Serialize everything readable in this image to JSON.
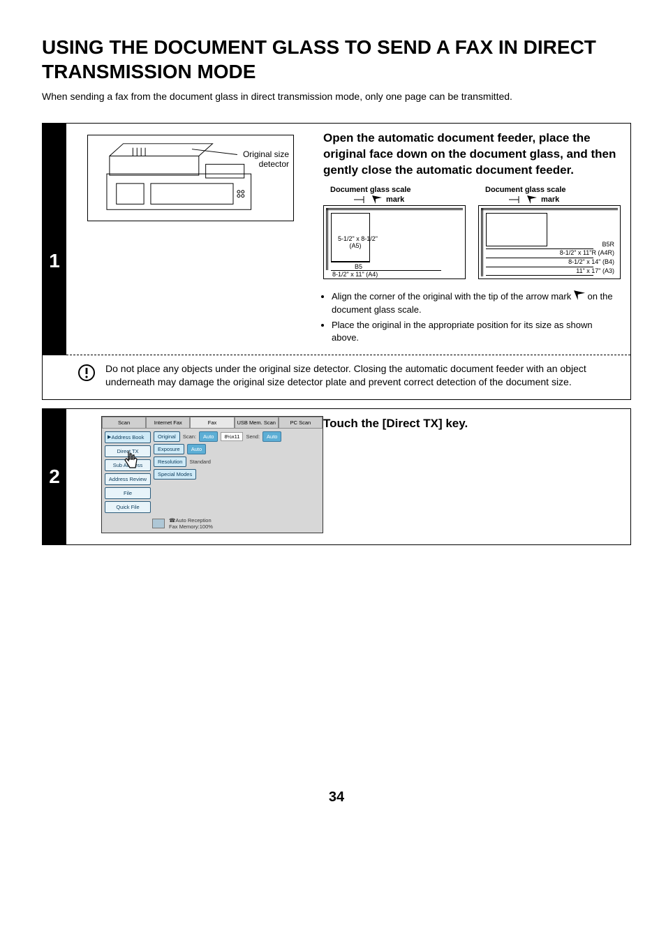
{
  "title": "USING THE DOCUMENT GLASS TO SEND A FAX IN DIRECT TRANSMISSION MODE",
  "intro": "When sending a fax from the document glass in direct transmission mode, only one page can be transmitted.",
  "step1": {
    "num": "1",
    "illust_label": "Original size\ndetector",
    "heading": "Open the automatic document feeder, place the original face down on the document glass, and then gently close the automatic document feeder.",
    "scale_head": "Document glass scale",
    "mark_label": "mark",
    "left_scale": {
      "l1": "5-1/2\" x 8-1/2\"\n(A5)",
      "l2": "B5",
      "l3": "8-1/2\" x 11\" (A4)"
    },
    "right_scale": {
      "l1": "B5R",
      "l2": "8-1/2\" x 11\"R (A4R)",
      "l3": "8-1/2\" x 14\" (B4)",
      "l4": "11\" x 17\" (A3)"
    },
    "bullet1_a": "Align the corner of the original with the tip of the arrow mark",
    "bullet1_b": "on the document glass scale.",
    "bullet2": "Place the original in the appropriate position for its size as shown above."
  },
  "caution": "Do not place any objects under the original size detector. Closing the automatic document feeder with an object underneath may damage the original size detector plate and prevent correct detection of the document size.",
  "step2": {
    "num": "2",
    "heading": "Touch the [Direct TX] key.",
    "tabs": [
      "Scan",
      "Internet Fax",
      "Fax",
      "USB Mem. Scan",
      "PC Scan"
    ],
    "side": [
      "Address Book",
      "Direct TX",
      "Sub Address",
      "Address Review",
      "File",
      "Quick File"
    ],
    "rows": {
      "original": "Original",
      "scan": "Scan:",
      "auto": "Auto",
      "x11": "8½x11",
      "send": "Send:",
      "exposure": "Exposure",
      "resolution": "Resolution",
      "standard": "Standard",
      "special": "Special Modes"
    },
    "footer1": "Auto Reception",
    "footer2": "Fax Memory:100%"
  },
  "page_number": "34"
}
